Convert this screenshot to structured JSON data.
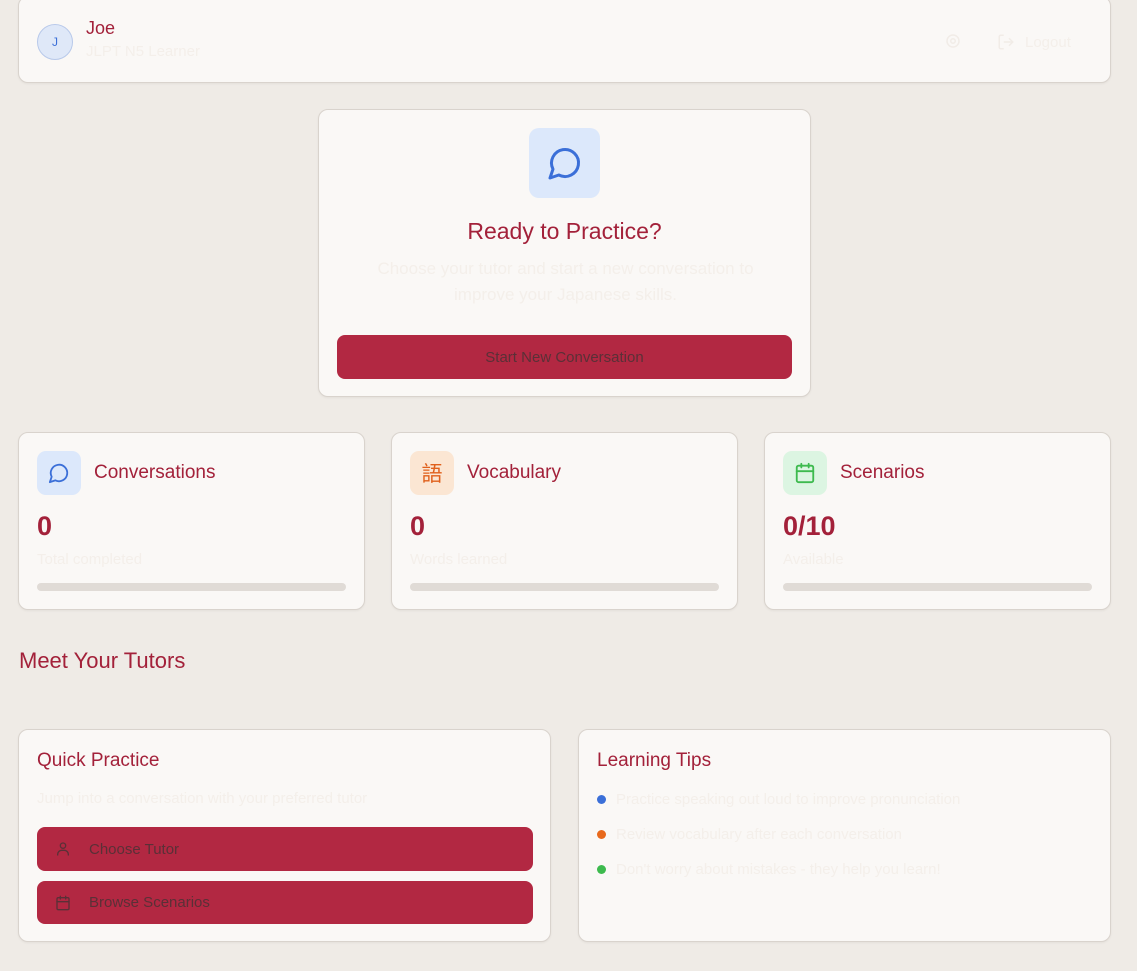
{
  "header": {
    "avatar_initial": "J",
    "user_name": "Joe",
    "user_role": "JLPT N5 Learner",
    "settings_icon": "settings-icon",
    "logout_label": "Logout"
  },
  "hero": {
    "icon": "chat-bubble-icon",
    "title": "Ready to Practice?",
    "subtitle": "Choose your tutor and start a new conversation to improve your Japanese skills.",
    "button_label": "Start New Conversation"
  },
  "stats": [
    {
      "title": "Conversations",
      "value": "0",
      "subtitle": "Total completed",
      "icon": "chat-bubble-icon",
      "icon_bg": "#dce8fb",
      "progress": 0
    },
    {
      "title": "Vocabulary",
      "value": "0",
      "subtitle": "Words learned",
      "icon": "kanji-go-icon",
      "icon_glyph": "語",
      "icon_bg": "#fbe6d3",
      "progress": 0
    },
    {
      "title": "Scenarios",
      "value": "0/10",
      "subtitle": "Available",
      "icon": "calendar-icon",
      "icon_bg": "#dcf5e2",
      "progress": 0
    }
  ],
  "tutors_section": {
    "title": "Meet Your Tutors"
  },
  "quick_practice": {
    "title": "Quick Practice",
    "subtitle": "Jump into a conversation with your preferred tutor",
    "choose_tutor_label": "Choose Tutor",
    "browse_scenarios_label": "Browse Scenarios"
  },
  "learning_tips": {
    "title": "Learning Tips",
    "tips": [
      {
        "text": "Practice speaking out loud to improve pronunciation",
        "color": "#3b6fd8"
      },
      {
        "text": "Review vocabulary after each conversation",
        "color": "#e8691c"
      },
      {
        "text": "Don't worry about mistakes - they help you learn!",
        "color": "#3dba4e"
      }
    ]
  },
  "colors": {
    "accent": "#a3213a",
    "button": "#b22842",
    "background": "#efebe6",
    "card": "#faf8f6"
  }
}
